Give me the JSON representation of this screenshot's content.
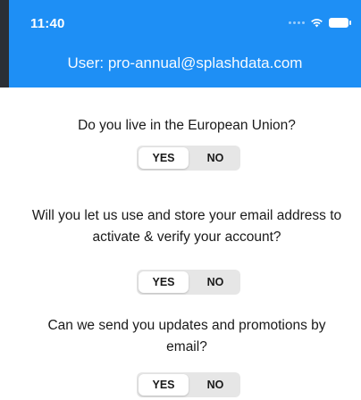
{
  "status_bar": {
    "time": "11:40",
    "icons": [
      "signal-dots-icon",
      "wifi-icon",
      "battery-icon"
    ]
  },
  "header": {
    "user_text": "User: pro-annual@splashdata.com"
  },
  "questions": [
    {
      "text": "Do you live in the European Union?",
      "yes": "YES",
      "no": "NO",
      "selected": "YES"
    },
    {
      "text": "Will you let us use and store your email address to activate & verify your account?",
      "yes": "YES",
      "no": "NO",
      "selected": "YES"
    },
    {
      "text": "Can we send you updates and promotions by email?",
      "yes": "YES",
      "no": "NO",
      "selected": "YES"
    }
  ],
  "colors": {
    "header": "#1e8ff5",
    "toggle_track": "#e6e6e6",
    "toggle_selected": "#ffffff"
  }
}
